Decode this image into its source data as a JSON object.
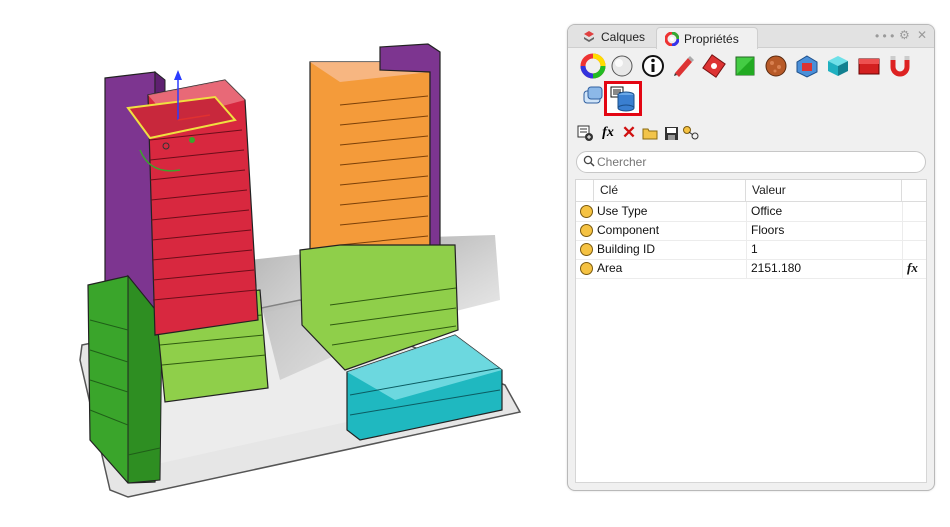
{
  "tabs": [
    {
      "label": "Calques",
      "icon": "layers-icon"
    },
    {
      "label": "Propriétés",
      "icon": "color-wheel-icon"
    }
  ],
  "tab_controls": [
    "more-dots-icon",
    "gear-icon",
    "close-icon"
  ],
  "property_icons": [
    "color-wheel-icon",
    "sphere-icon",
    "info-icon",
    "pencil-icon",
    "texture-icon",
    "green-square-icon",
    "bumpy-ball-icon",
    "decal-icon",
    "cube-icon",
    "red-box-icon",
    "magnet-icon",
    "flow-icon",
    "database-icon"
  ],
  "toolbar_icons": [
    "add-key-icon",
    "fx-icon",
    "delete-icon",
    "folder-icon",
    "save-icon",
    "link-key-icon"
  ],
  "search": {
    "placeholder": "Chercher"
  },
  "table": {
    "headers": [
      "Clé",
      "Valeur"
    ],
    "rows": [
      {
        "key": "Use Type",
        "value": "Office",
        "fx": ""
      },
      {
        "key": "Component",
        "value": "Floors",
        "fx": ""
      },
      {
        "key": "Building ID",
        "value": "1",
        "fx": ""
      },
      {
        "key": "Area",
        "value": "2151.180",
        "fx": "fx"
      }
    ]
  },
  "colors": {
    "selection_highlight": "#e30613",
    "panel_bg": "#f0f0f0",
    "dot": "#f5c242"
  }
}
